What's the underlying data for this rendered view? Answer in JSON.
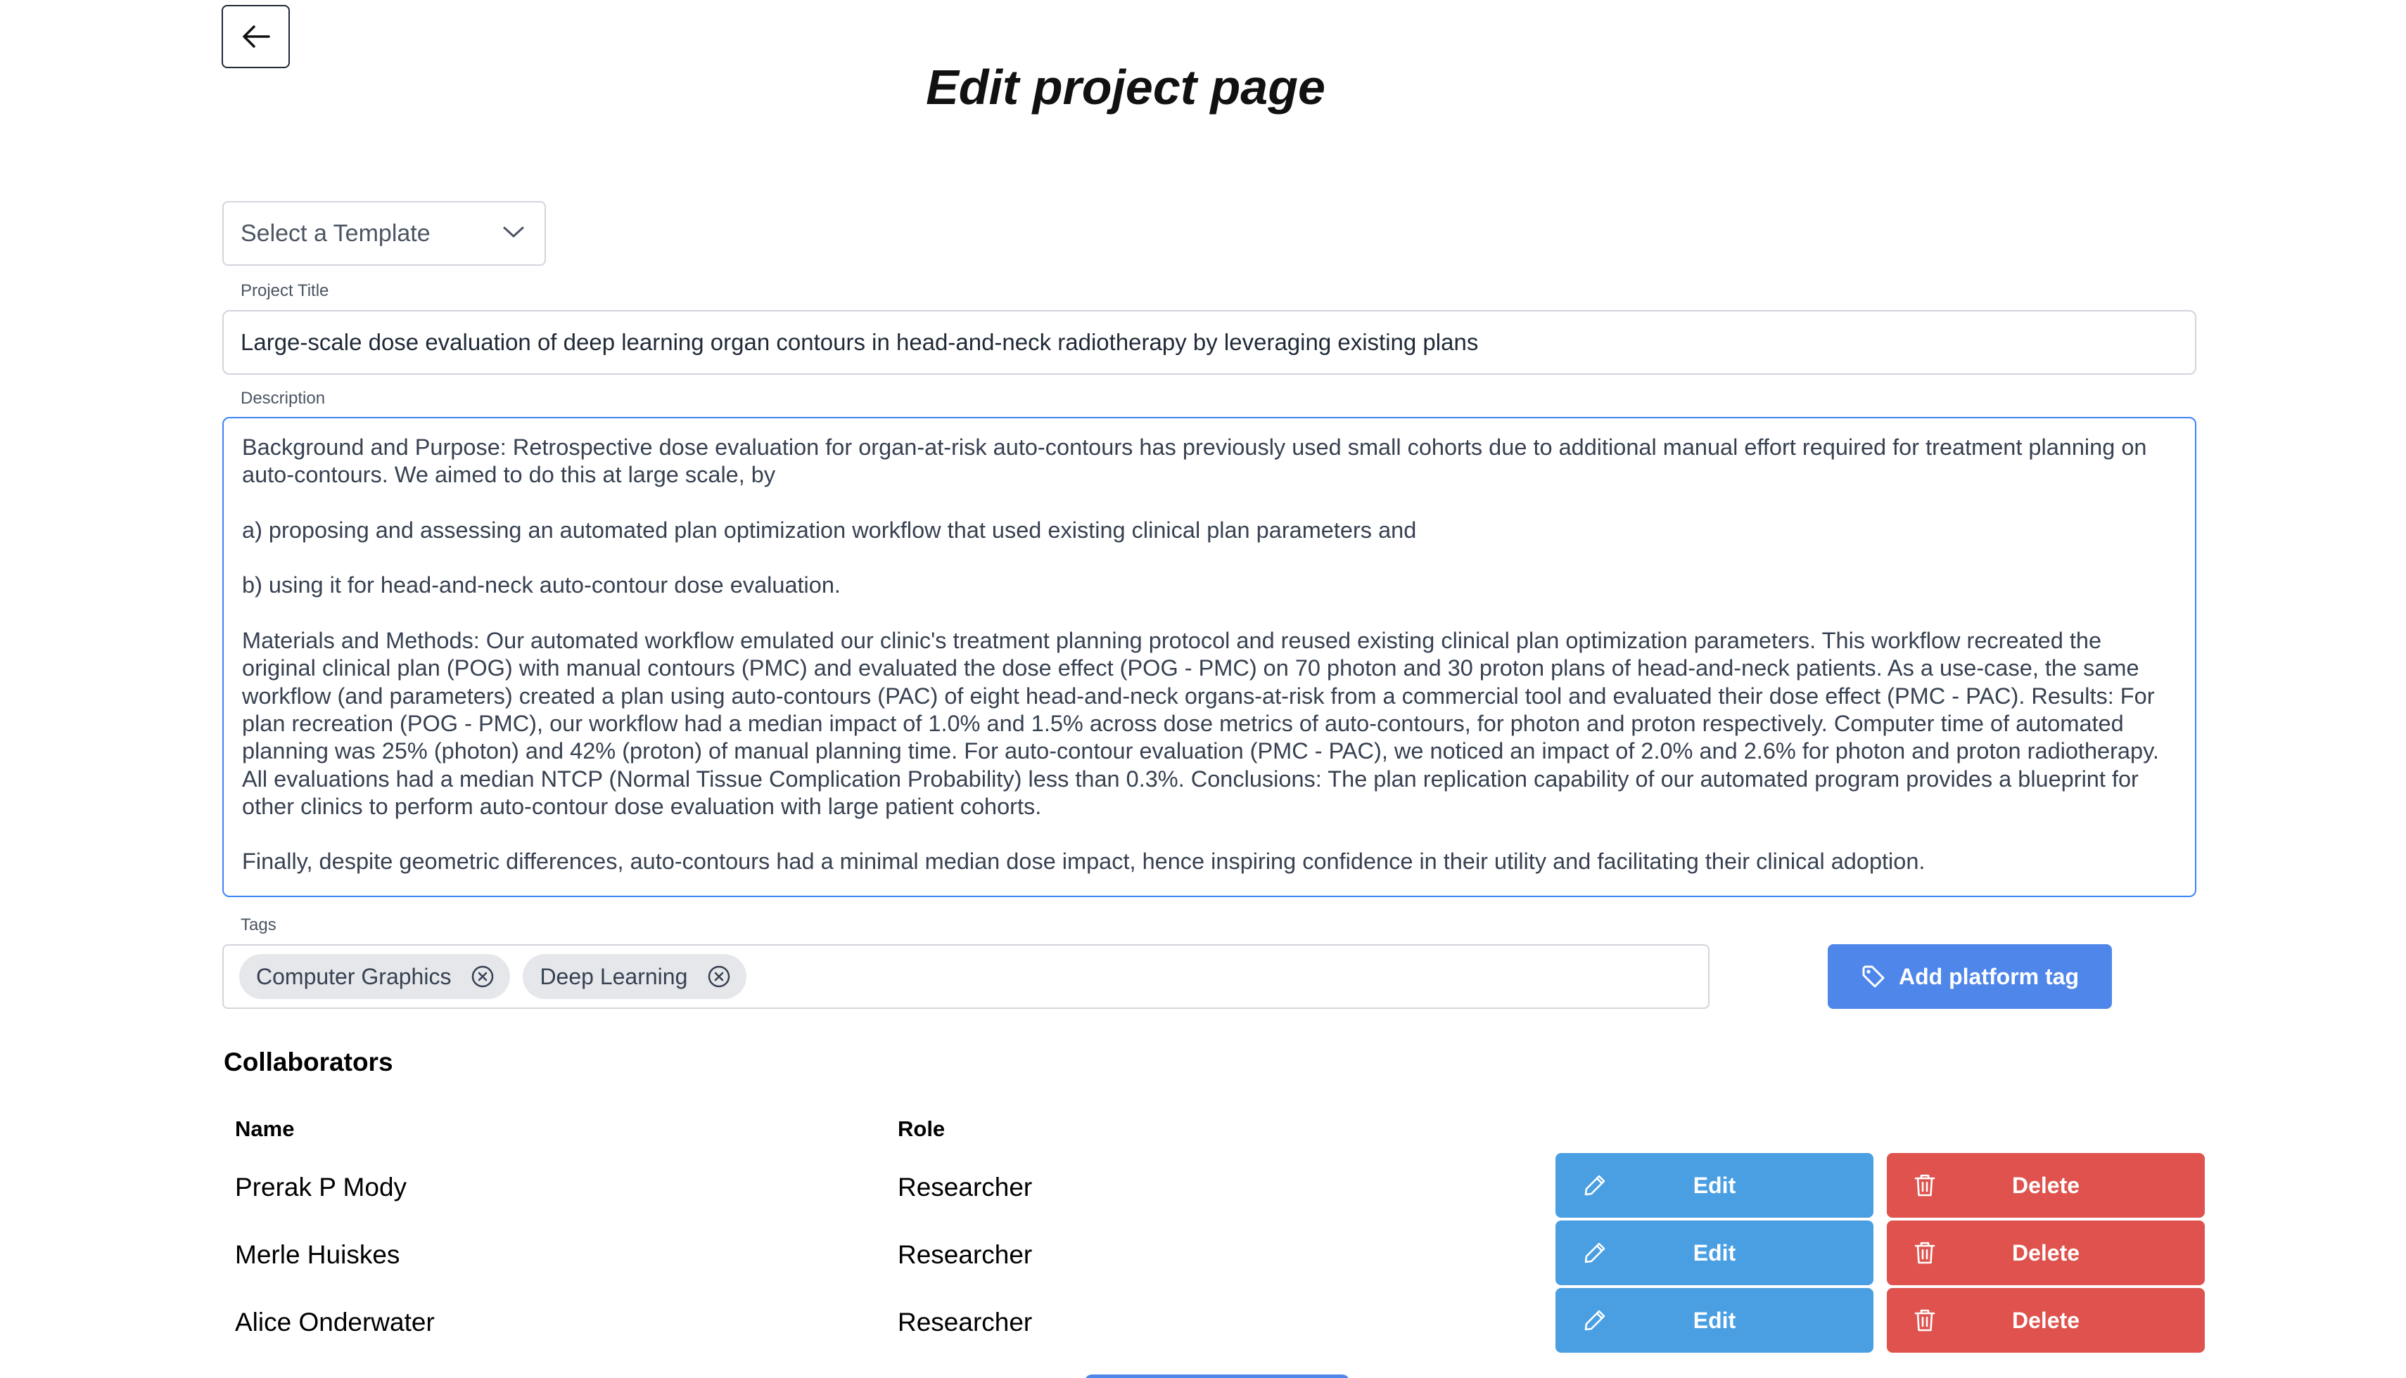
{
  "header": {
    "back_icon": "arrow-left-icon",
    "title": "Edit project page"
  },
  "template_select": {
    "selected": "Select a Template",
    "icon": "chevron-down-icon"
  },
  "project_title": {
    "label": "Project Title",
    "value": "Large-scale dose evaluation of deep learning organ contours in head-and-neck radiotherapy by leveraging existing plans"
  },
  "description": {
    "label": "Description",
    "paragraphs": [
      "Background and Purpose: Retrospective dose evaluation for organ-at-risk auto-contours has previously used small cohorts due to additional manual effort required for treatment planning on auto-contours. We aimed to do this at large scale, by",
      "a) proposing and assessing an automated plan optimization workflow that used existing clinical plan parameters and",
      "b) using it for head-and-neck auto-contour dose evaluation.",
      "Materials and Methods: Our automated workflow emulated our clinic's treatment planning protocol and reused existing clinical plan optimization parameters. This workflow recreated the original clinical plan (POG) with manual contours (PMC) and evaluated the dose effect (POG - PMC) on 70 photon and 30 proton plans of head-and-neck patients. As a use-case, the same workflow (and parameters) created a plan using auto-contours (PAC) of eight head-and-neck organs-at-risk from a commercial tool and evaluated their dose effect (PMC - PAC). Results: For plan recreation (POG - PMC), our workflow had a median impact of 1.0% and 1.5% across dose metrics of auto-contours, for photon and proton respectively. Computer time of automated planning was 25% (photon) and 42% (proton) of manual planning time. For auto-contour evaluation (PMC - PAC), we noticed an impact of 2.0% and 2.6% for photon and proton radiotherapy. All evaluations had a median NTCP (Normal Tissue Complication Probability) less than 0.3%. Conclusions: The plan replication capability of our automated program provides a blueprint for other clinics to perform auto-contour dose evaluation with large patient cohorts.",
      "Finally, despite geometric differences, auto-contours had a minimal median dose impact, hence inspiring confidence in their utility and facilitating their clinical adoption."
    ]
  },
  "tags": {
    "label": "Tags",
    "items": [
      {
        "label": "Computer Graphics",
        "remove_icon": "circle-x-icon"
      },
      {
        "label": "Deep Learning",
        "remove_icon": "circle-x-icon"
      }
    ],
    "add_button_label": "Add platform tag",
    "add_button_icon": "tag-icon"
  },
  "collaborators": {
    "heading": "Collaborators",
    "columns": [
      "Name",
      "Role"
    ],
    "rows": [
      {
        "name": "Prerak P Mody",
        "role": "Researcher"
      },
      {
        "name": "Merle Huiskes",
        "role": "Researcher"
      },
      {
        "name": "Alice Onderwater",
        "role": "Researcher"
      }
    ],
    "edit_label": "Edit",
    "edit_icon": "pencil-icon",
    "delete_label": "Delete",
    "delete_icon": "trash-icon"
  },
  "colors": {
    "primary_blue": "#4f86e9",
    "edit_blue": "#4a9fe3",
    "delete_red": "#df524d",
    "focus_border": "#3b82f6"
  }
}
